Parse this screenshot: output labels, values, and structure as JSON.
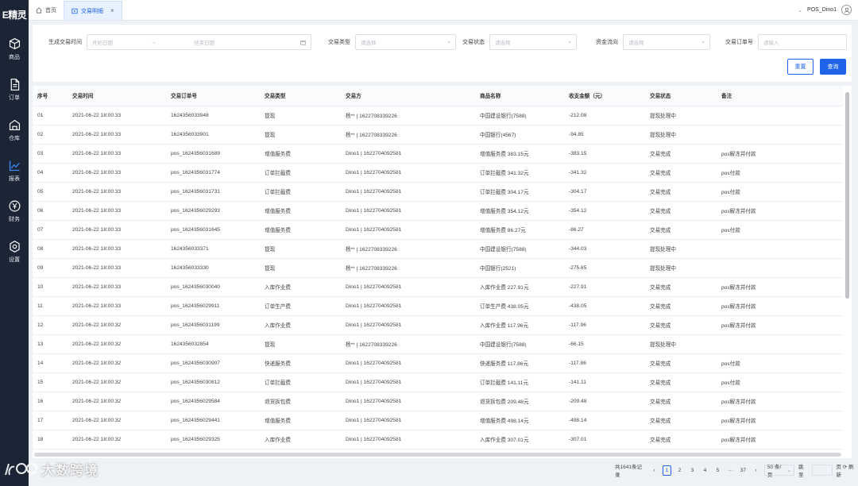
{
  "app": {
    "logo": "E精灵"
  },
  "sidebar": {
    "items": [
      {
        "label": "商品",
        "icon": "cube-icon"
      },
      {
        "label": "订单",
        "icon": "document-icon"
      },
      {
        "label": "仓库",
        "icon": "warehouse-icon"
      },
      {
        "label": "报表",
        "icon": "chart-icon"
      },
      {
        "label": "财务",
        "icon": "yen-icon"
      },
      {
        "label": "设置",
        "icon": "gear-icon"
      }
    ]
  },
  "tabs": [
    {
      "label": "首页",
      "icon": "home-icon"
    },
    {
      "label": "交易明细",
      "icon": "detail-icon"
    }
  ],
  "user": {
    "name": "POS_Dino1"
  },
  "filters": {
    "time_label": "生成交易时间",
    "start_placeholder": "开始日期",
    "end_placeholder": "结束日期",
    "type_label": "交易类型",
    "type_placeholder": "请选择",
    "status_label": "交易状态",
    "status_placeholder": "请选择",
    "flow_label": "资金流向",
    "flow_placeholder": "请选择",
    "order_label": "交易订单号",
    "order_placeholder": "请输入",
    "reset": "重置",
    "query": "查询"
  },
  "table": {
    "headers": [
      "序号",
      "交易时间",
      "交易订单号",
      "交易类型",
      "交易方",
      "商品名称",
      "收支金额（元）",
      "交易状态",
      "备注"
    ],
    "rows": [
      [
        "01",
        "2021-06-22 18:00:33",
        "1624356033948",
        "提现",
        "杨** | 1622708339226",
        "中国建设银行(7588)",
        "-212.08",
        "提现处理中",
        ""
      ],
      [
        "02",
        "2021-06-22 18:00:33",
        "1624356033901",
        "提现",
        "杨** | 1622708339226",
        "中国银行(4567)",
        "-94.85",
        "提现处理中",
        ""
      ],
      [
        "03",
        "2021-06-22 18:00:33",
        "pos_1624356031689",
        "增值服务费",
        "Dino1 | 1622704092581",
        "增值服务费 383.15元",
        "-383.15",
        "交易完成",
        "pos解冻并付款"
      ],
      [
        "04",
        "2021-06-22 18:00:33",
        "pos_1624356031774",
        "订单拦截费",
        "Dino1 | 1622704092581",
        "订单拦截费 341.32元",
        "-341.32",
        "交易完成",
        "pos付款"
      ],
      [
        "05",
        "2021-06-22 18:00:33",
        "pos_1624356031731",
        "订单拦截费",
        "Dino1 | 1622704092581",
        "订单拦截费 304.17元",
        "-304.17",
        "交易完成",
        "pos付款"
      ],
      [
        "06",
        "2021-06-22 18:00:33",
        "pos_1624356029293",
        "增值服务费",
        "Dino1 | 1622704092581",
        "增值服务费 354.12元",
        "-354.12",
        "交易完成",
        "pos解冻并付款"
      ],
      [
        "07",
        "2021-06-22 18:00:33",
        "pos_1624356031645",
        "增值服务费",
        "Dino1 | 1622704092581",
        "增值服务费 86.27元",
        "-86.27",
        "交易完成",
        "pos付款"
      ],
      [
        "08",
        "2021-06-22 18:00:33",
        "1624356033371",
        "提现",
        "杨** | 1622708339226",
        "中国建设银行(7588)",
        "-344.03",
        "提现处理中",
        ""
      ],
      [
        "09",
        "2021-06-22 18:00:33",
        "1624356033330",
        "提现",
        "杨** | 1622708339226",
        "中国银行(2521)",
        "-275.65",
        "提现处理中",
        ""
      ],
      [
        "10",
        "2021-06-22 18:00:33",
        "pos_1624356030040",
        "入库作业费",
        "Dino1 | 1622704092581",
        "入库作业费 227.91元",
        "-227.91",
        "交易完成",
        "pos解冻并付款"
      ],
      [
        "11",
        "2021-06-22 18:00:33",
        "pos_1624356029911",
        "订单生产费",
        "Dino1 | 1622704092581",
        "订单生产费 438.05元",
        "-438.05",
        "交易完成",
        "pos解冻并付款"
      ],
      [
        "12",
        "2021-06-22 18:00:32",
        "pos_1624356031199",
        "入库作业费",
        "Dino1 | 1622704092581",
        "入库作业费 117.96元",
        "-117.96",
        "交易完成",
        "pos解冻并付款"
      ],
      [
        "13",
        "2021-06-22 18:00:32",
        "1624356032854",
        "提现",
        "杨** | 1622708339226",
        "中国建设银行(7588)",
        "-66.15",
        "提现处理中",
        ""
      ],
      [
        "14",
        "2021-06-22 18:00:32",
        "pos_1624356030907",
        "快递服务费",
        "Dino1 | 1622704092581",
        "快递服务费 117.86元",
        "-117.86",
        "交易完成",
        "pos付款"
      ],
      [
        "15",
        "2021-06-22 18:00:32",
        "pos_1624356030812",
        "订单拦截费",
        "Dino1 | 1622704092581",
        "订单拦截费 141.11元",
        "-141.11",
        "交易完成",
        "pos付款"
      ],
      [
        "16",
        "2021-06-22 18:00:32",
        "pos_1624356029584",
        "退货拆包费",
        "Dino1 | 1622704092581",
        "退货拆包费 209.48元",
        "-209.48",
        "交易完成",
        "pos解冻并付款"
      ],
      [
        "17",
        "2021-06-22 18:00:32",
        "pos_1624356029441",
        "增值服务费",
        "Dino1 | 1622704092581",
        "增值服务费 498.14元",
        "-498.14",
        "交易完成",
        "pos解冻并付款"
      ],
      [
        "18",
        "2021-06-22 18:00:32",
        "pos_1624356029325",
        "入库作业费",
        "Dino1 | 1622704092581",
        "入库作业费 307.01元",
        "-307.01",
        "交易完成",
        "pos解冻并付款"
      ]
    ]
  },
  "pagination": {
    "total": "共1641条记录",
    "prev": "‹",
    "pages": [
      "1",
      "2",
      "3",
      "4",
      "5"
    ],
    "ellipsis": "···",
    "last": "37",
    "next": "›",
    "page_size": "50 条/页",
    "jump_label": "跳至",
    "refresh": "页 ⟳ 刷新"
  },
  "watermark": "大数跨境"
}
